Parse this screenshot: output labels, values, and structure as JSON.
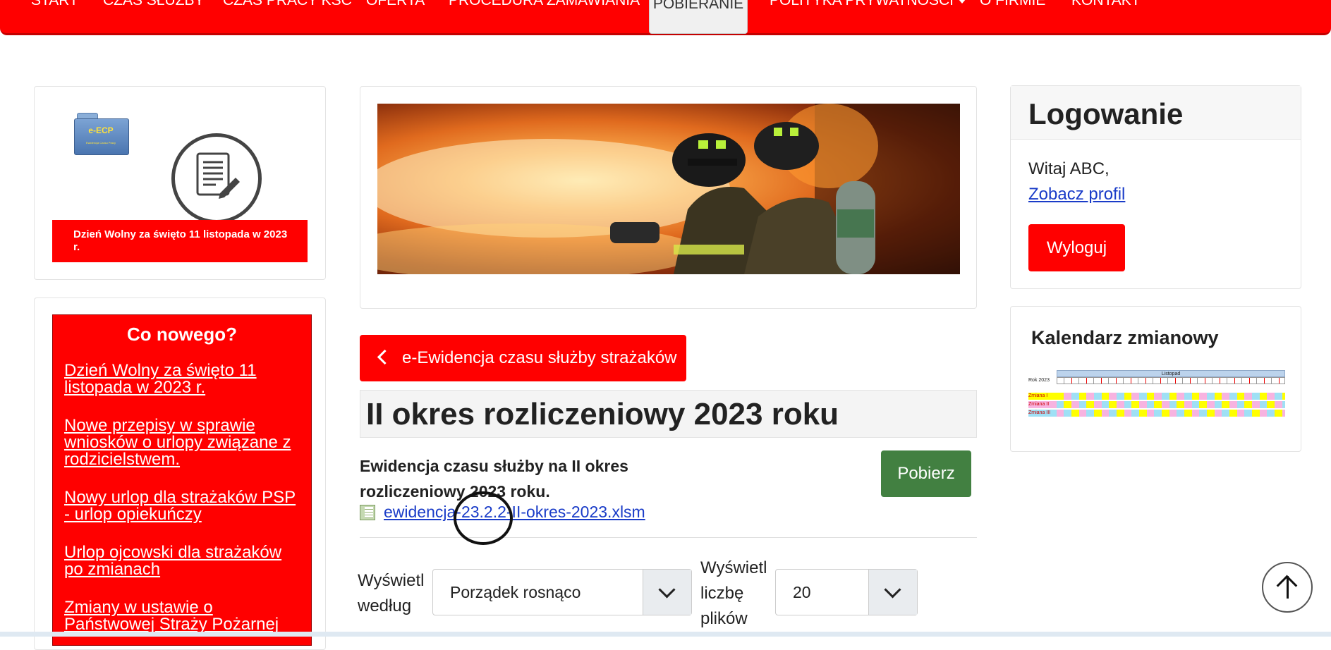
{
  "nav": {
    "items": [
      "START",
      "CZAS SŁUŻBY",
      "CZAS PRACY KSC",
      "OFERTA",
      "PROCEDURA ZAMAWIANIA",
      "POBIERANIE",
      "POLITYKA PRYWATNOŚCI",
      "O FIRMIE",
      "KONTAKT"
    ],
    "active": "POBIERANIE",
    "colors": {
      "brand_red": "#ff0000",
      "active_bg": "#f0f0f0"
    }
  },
  "promo": {
    "folder_label": "e-ECP",
    "folder_sub": "Ewidencja Czasu Pracy",
    "banner": "Dzień Wolny za święto 11 listopada w 2023 r."
  },
  "news": {
    "title": "Co nowego?",
    "links": [
      "Dzień Wolny za święto 11 listopada w 2023 r.",
      "Nowe przepisy w sprawie wniosków o urlopy związane z rodzicielstwem.",
      "Nowy urlop dla strażaków PSP - urlop opiekuńczy",
      "Urlop ojcowski dla strażaków po zmianach",
      "Zmiany w ustawie o Państwowej Straży Pożarnej"
    ]
  },
  "main": {
    "back_button": "e-Ewidencja czasu służby strażaków",
    "title": "II okres rozliczeniowy 2023 roku",
    "file_description": "Ewidencja czasu służby na II okres rozliczeniowy 2023 roku.",
    "file_name": "ewidencja-23.2.2-II-okres-2023.xlsm",
    "download_button": "Pobierz",
    "sort_label": "Wyświetl według",
    "sort_value": "Porządek rosnąco",
    "count_label": "Wyświetl liczbę plików",
    "count_value": "20"
  },
  "sidebar": {
    "login_title": "Logowanie",
    "greeting": "Witaj ABC,",
    "profile_link": "Zobacz profil",
    "logout_button": "Wyloguj",
    "calendar_title": "Kalendarz zmianowy",
    "calendar_year": "Rok 2023",
    "calendar_month": "Listopad",
    "calendar_rows": [
      "Zmiana I",
      "Zmiana II",
      "Zmiana III"
    ]
  }
}
